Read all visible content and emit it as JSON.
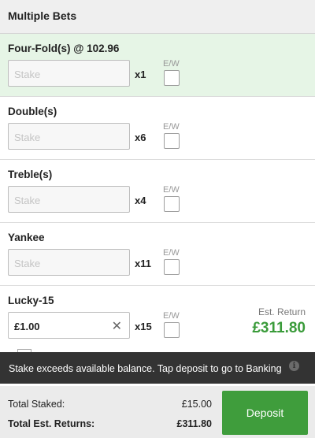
{
  "header": {
    "title": "Multiple Bets"
  },
  "bets": [
    {
      "title": "Four-Fold(s) @ 102.96",
      "stake_placeholder": "Stake",
      "multiplier": "x1",
      "ew_label": "E/W"
    },
    {
      "title": "Double(s)",
      "stake_placeholder": "Stake",
      "multiplier": "x6",
      "ew_label": "E/W"
    },
    {
      "title": "Treble(s)",
      "stake_placeholder": "Stake",
      "multiplier": "x4",
      "ew_label": "E/W"
    },
    {
      "title": "Yankee",
      "stake_placeholder": "Stake",
      "multiplier": "x11",
      "ew_label": "E/W"
    },
    {
      "title": "Lucky-15",
      "stake_value": "£1.00",
      "multiplier": "x15",
      "ew_label": "E/W",
      "est_return_label": "Est. Return",
      "est_return_value": "£311.80"
    }
  ],
  "toast": {
    "message": "Stake exceeds available balance. Tap deposit to go to Banking",
    "icon": "info-icon"
  },
  "footer": {
    "total_staked_label": "Total Staked:",
    "total_staked_value": "£15.00",
    "total_returns_label": "Total Est. Returns:",
    "total_returns_value": "£311.80",
    "deposit_label": "Deposit"
  },
  "colors": {
    "accent_green": "#3f9d3c",
    "return_green": "#3a9b3a",
    "highlight_row": "#e6f5e6",
    "toast_bg": "#333333"
  }
}
